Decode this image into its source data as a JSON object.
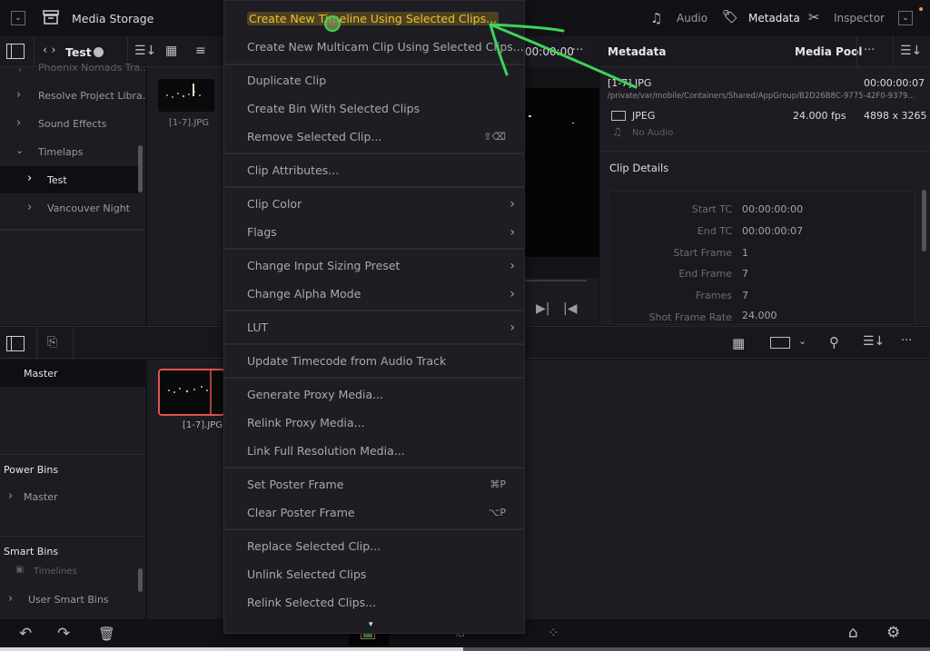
{
  "topbar": {
    "media_storage_label": "Media Storage",
    "audio_label": "Audio",
    "metadata_label": "Metadata",
    "inspector_label": "Inspector"
  },
  "media_browser": {
    "bin_name": "Test",
    "tree": [
      {
        "label": "Phoenix Nomads Tra...",
        "expanded": false
      },
      {
        "label": "Resolve Project Libra...",
        "expanded": false
      },
      {
        "label": "Sound Effects",
        "expanded": false
      },
      {
        "label": "Timelaps",
        "expanded": true
      },
      {
        "label": "Test",
        "expanded": false,
        "selected": true
      },
      {
        "label": "Vancouver Night",
        "expanded": false
      }
    ],
    "clip_name": "[1-7].JPG"
  },
  "viewer": {
    "timecode": "00:00:00"
  },
  "metadata": {
    "title": "Metadata",
    "media_pool_label": "Media Pool",
    "clip_name": "[1-7].JPG",
    "duration": "00:00:00:07",
    "path": "/private/var/mobile/Containers/Shared/AppGroup/B2D26B8C-9775-42F0-9379...",
    "format": "JPEG",
    "fps": "24.000 fps",
    "resolution": "4898 x 3265",
    "audio": "No Audio",
    "clip_details_title": "Clip Details",
    "fields": [
      {
        "label": "Start TC",
        "value": "00:00:00:00"
      },
      {
        "label": "End TC",
        "value": "00:00:00:07"
      },
      {
        "label": "Start Frame",
        "value": "1"
      },
      {
        "label": "End Frame",
        "value": "7"
      },
      {
        "label": "Frames",
        "value": "7"
      },
      {
        "label": "Shot Frame Rate",
        "value": "24.000"
      }
    ]
  },
  "media_pool": {
    "master_label": "Master",
    "clip_name": "[1-7].JPG",
    "power_bins_label": "Power Bins",
    "power_bins_master": "Master",
    "smart_bins_label": "Smart Bins",
    "timelines_label": "Timelines",
    "user_smart_bins_label": "User Smart Bins"
  },
  "context_menu": {
    "items": [
      {
        "label": "Create New Timeline Using Selected Clips...",
        "highlighted": true
      },
      {
        "label": "Create New Multicam Clip Using Selected Clips..."
      },
      {
        "label": "Duplicate Clip"
      },
      {
        "label": "Create Bin With Selected Clips"
      },
      {
        "label": "Remove Selected Clip...",
        "shortcut": "⇧⌫"
      },
      {
        "label": "Clip Attributes..."
      },
      {
        "label": "Clip Color",
        "submenu": true
      },
      {
        "label": "Flags",
        "submenu": true
      },
      {
        "label": "Change Input Sizing Preset",
        "submenu": true
      },
      {
        "label": "Change Alpha Mode",
        "submenu": true
      },
      {
        "label": "LUT",
        "submenu": true
      },
      {
        "label": "Update Timecode from Audio Track"
      },
      {
        "label": "Generate Proxy Media..."
      },
      {
        "label": "Relink Proxy Media..."
      },
      {
        "label": "Link Full Resolution Media..."
      },
      {
        "label": "Set Poster Frame",
        "shortcut": "⌘P"
      },
      {
        "label": "Clear Poster Frame",
        "shortcut": "⌥P"
      },
      {
        "label": "Replace Selected Clip..."
      },
      {
        "label": "Unlink Selected Clips"
      },
      {
        "label": "Relink Selected Clips..."
      }
    ],
    "submenu_glyph": "›",
    "more_glyph": "▾"
  },
  "colors": {
    "highlight_text": "#e8c13a",
    "annotation_green": "#3fd35a",
    "selected_clip_border": "#e0524f"
  }
}
